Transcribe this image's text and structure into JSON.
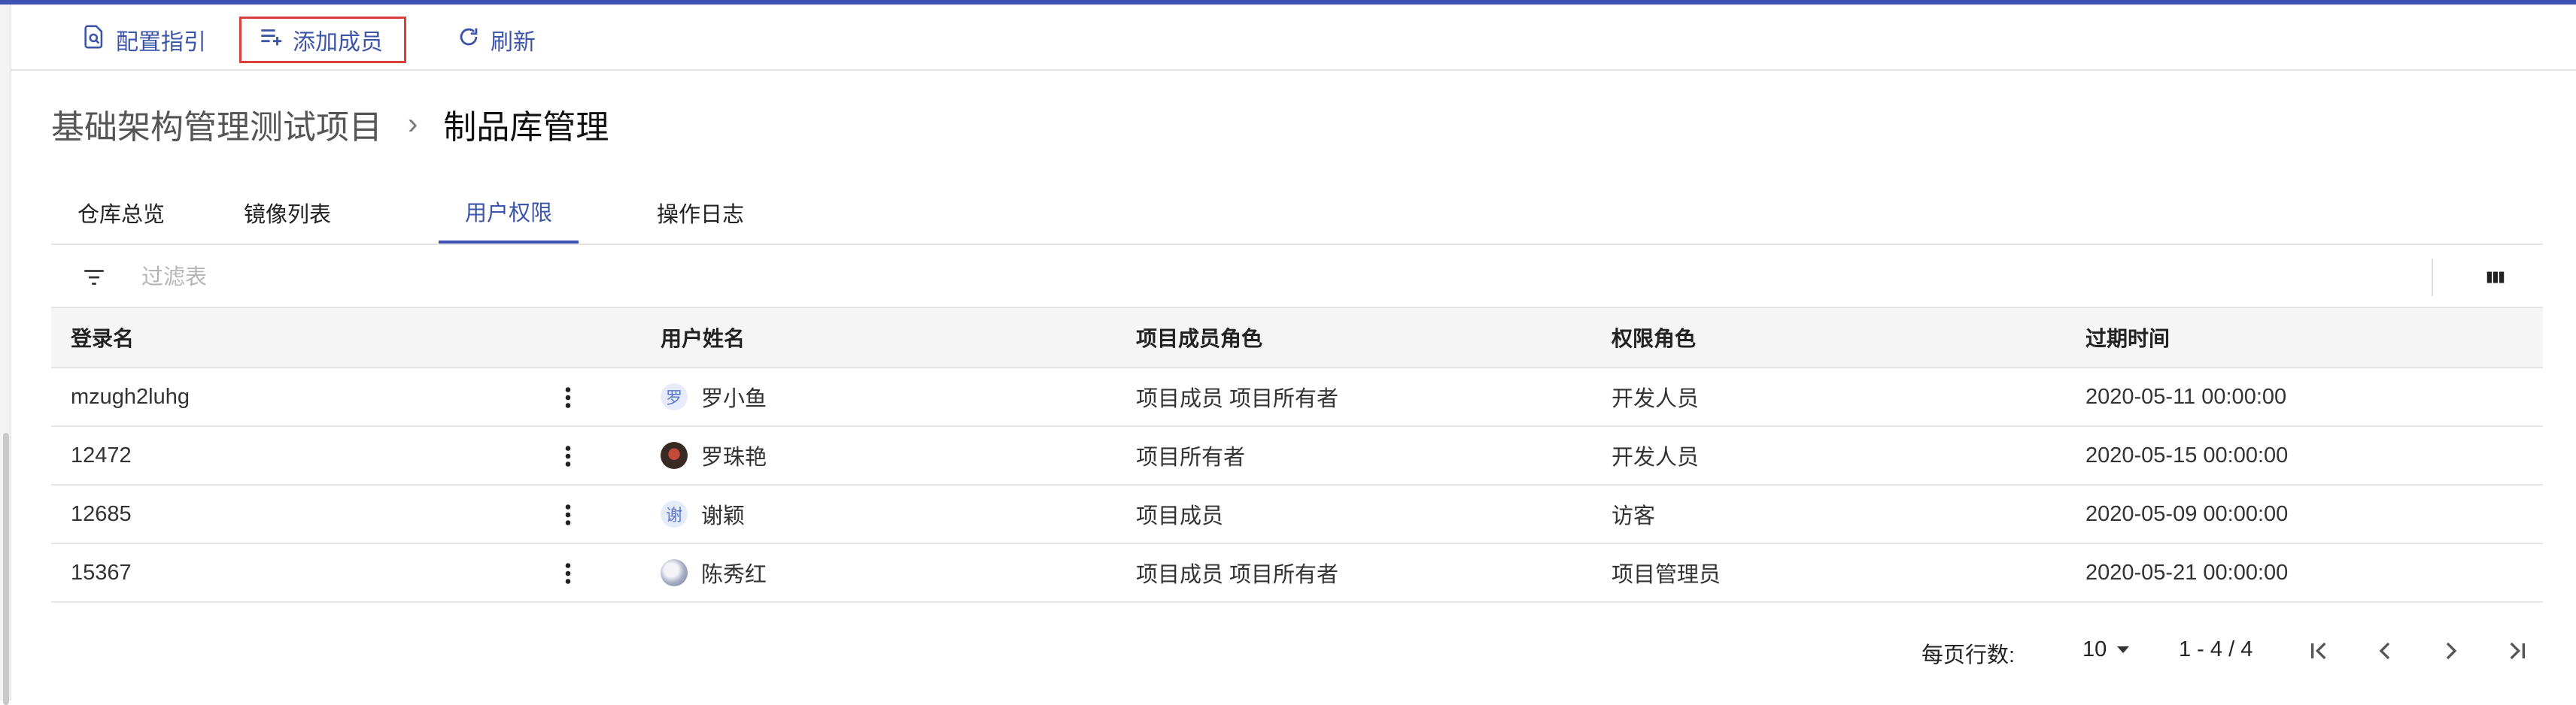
{
  "toolbar": {
    "config_guide": "配置指引",
    "add_member": "添加成员",
    "refresh": "刷新"
  },
  "breadcrumb": {
    "parent": "基础架构管理测试项目",
    "separator": "›",
    "current": "制品库管理"
  },
  "tabs": [
    {
      "label": "仓库总览"
    },
    {
      "label": "镜像列表"
    },
    {
      "label": "用户权限",
      "active": true
    },
    {
      "label": "操作日志"
    }
  ],
  "filter": {
    "placeholder": "过滤表"
  },
  "table": {
    "columns": [
      "登录名",
      "用户姓名",
      "项目成员角色",
      "权限角色",
      "过期时间"
    ],
    "rows": [
      {
        "login": "mzugh2luhg",
        "avatar_text": "罗",
        "name": "罗小鱼",
        "member_role": "项目成员 项目所有者",
        "perm_role": "开发人员",
        "expire": "2020-05-11 00:00:00"
      },
      {
        "login": "12472",
        "avatar_text": "",
        "name": "罗珠艳",
        "member_role": "项目所有者",
        "perm_role": "开发人员",
        "expire": "2020-05-15 00:00:00"
      },
      {
        "login": "12685",
        "avatar_text": "谢",
        "name": "谢颖",
        "member_role": "项目成员",
        "perm_role": "访客",
        "expire": "2020-05-09 00:00:00"
      },
      {
        "login": "15367",
        "avatar_text": "",
        "name": "陈秀红",
        "member_role": "项目成员 项目所有者",
        "perm_role": "项目管理员",
        "expire": "2020-05-21 00:00:00"
      }
    ]
  },
  "pagination": {
    "rows_per_page_label": "每页行数:",
    "rows_per_page": "10",
    "range": "1 - 4 / 4"
  },
  "icons": {
    "config_guide": "document-search-icon",
    "add_member": "playlist-add-icon",
    "refresh": "refresh-icon",
    "filter": "filter-list-icon",
    "columns": "view-column-icon"
  },
  "colors": {
    "accent": "#3f51b5",
    "link": "#3d55a8",
    "highlight_border": "#d9403a"
  }
}
